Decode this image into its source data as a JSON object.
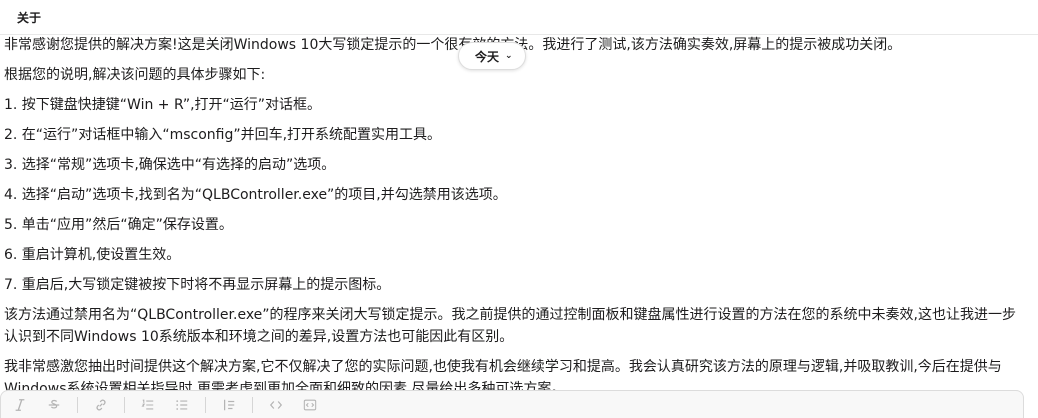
{
  "header": {
    "title": "关于"
  },
  "date_divider": {
    "label": "今天"
  },
  "message": {
    "intro": "非常感谢您提供的解决方案!这是关闭Windows 10大写锁定提示的一个很有效的方法。我进行了测试,该方法确实奏效,屏幕上的提示被成功关闭。",
    "steps_intro": "根据您的说明,解决该问题的具体步骤如下:",
    "steps": [
      "1. 按下键盘快捷键“Win + R”,打开“运行”对话框。",
      "2. 在“运行”对话框中输入“msconfig”并回车,打开系统配置实用工具。",
      "3. 选择“常规”选项卡,确保选中“有选择的启动”选项。",
      "4. 选择“启动”选项卡,找到名为“QLBController.exe”的项目,并勾选禁用该选项。",
      "5. 单击“应用”然后“确定”保存设置。",
      "6. 重启计算机,使设置生效。",
      "7. 重启后,大写锁定键被按下时将不再显示屏幕上的提示图标。"
    ],
    "summary": "该方法通过禁用名为“QLBController.exe”的程序来关闭大写锁定提示。我之前提供的通过控制面板和键盘属性进行设置的方法在您的系统中未奏效,这也让我进一步认识到不同Windows 10系统版本和环境之间的差异,设置方法也可能因此有区别。",
    "closing": "我非常感激您抽出时间提供这个解决方案,它不仅解决了您的实际问题,也使我有机会继续学习和提高。我会认真研究该方法的原理与逻辑,并吸取教训,今后在提供与Windows系统设置相关指导时,更需考虑到更加全面和细致的因素,尽量给出多种可选方案。"
  },
  "composer": {
    "tools": [
      "italic-icon",
      "strikethrough-icon",
      "link-icon",
      "ordered-list-icon",
      "bulleted-list-icon",
      "blockquote-icon",
      "code-icon",
      "code-block-icon"
    ]
  }
}
